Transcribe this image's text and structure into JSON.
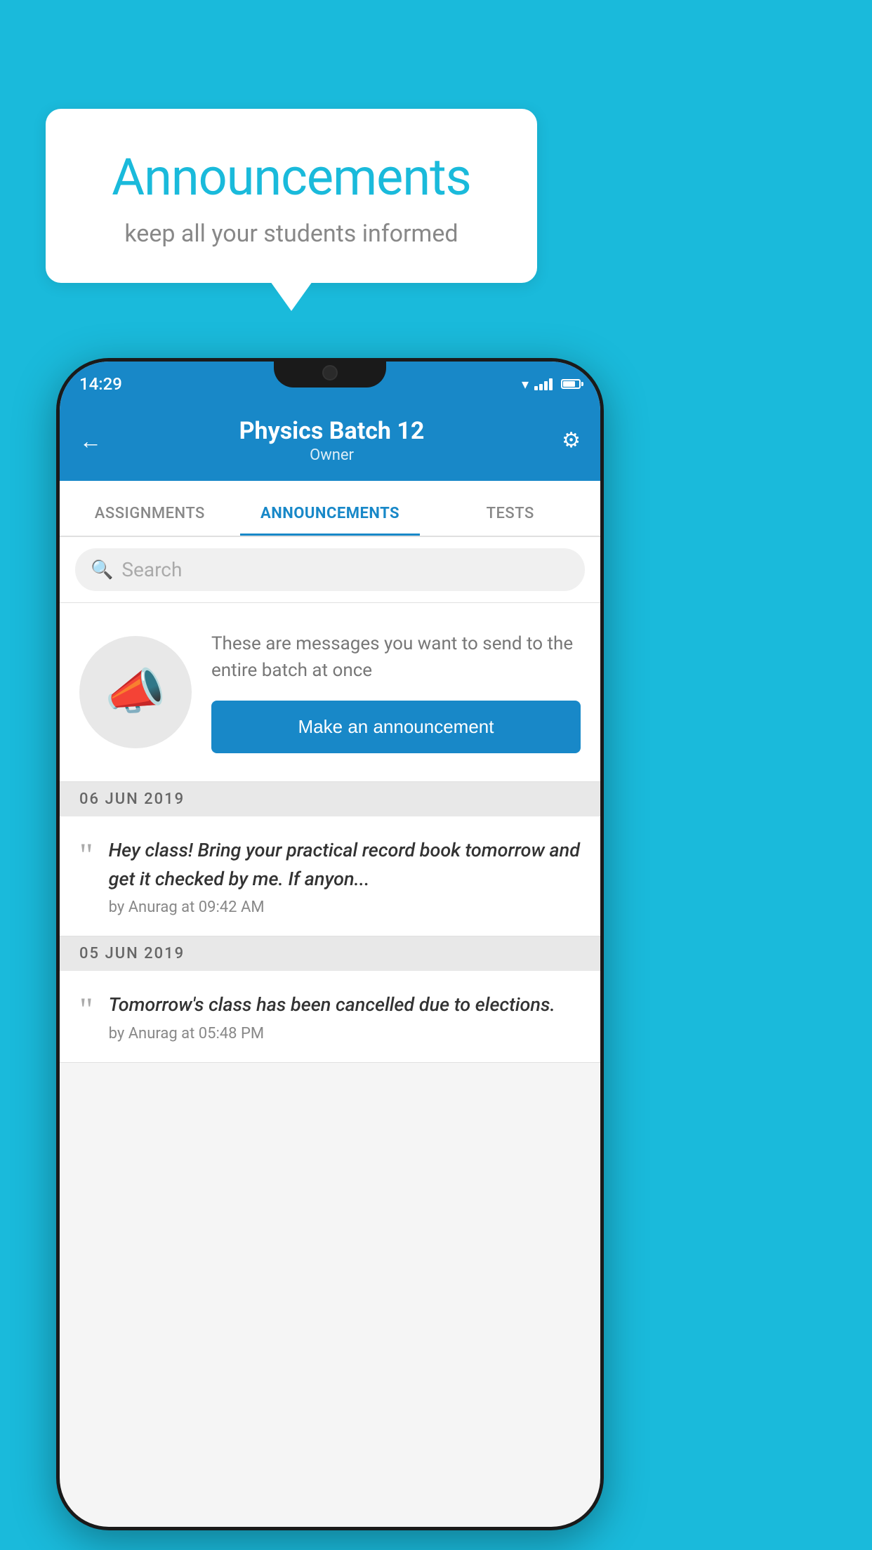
{
  "background": {
    "color": "#1ABADB"
  },
  "speech_bubble": {
    "title": "Announcements",
    "subtitle": "keep all your students informed"
  },
  "phone": {
    "status_bar": {
      "time": "14:29"
    },
    "header": {
      "title": "Physics Batch 12",
      "subtitle": "Owner",
      "back_label": "←",
      "settings_label": "⚙"
    },
    "tabs": [
      {
        "label": "ASSIGNMENTS",
        "active": false
      },
      {
        "label": "ANNOUNCEMENTS",
        "active": true
      },
      {
        "label": "TESTS",
        "active": false
      }
    ],
    "search": {
      "placeholder": "Search"
    },
    "announcement_prompt": {
      "description": "These are messages you want to send to the entire batch at once",
      "button_label": "Make an announcement"
    },
    "announcement_groups": [
      {
        "date": "06  JUN  2019",
        "items": [
          {
            "message": "Hey class! Bring your practical record book tomorrow and get it checked by me. If anyon...",
            "meta": "by Anurag at 09:42 AM"
          }
        ]
      },
      {
        "date": "05  JUN  2019",
        "items": [
          {
            "message": "Tomorrow's class has been cancelled due to elections.",
            "meta": "by Anurag at 05:48 PM"
          }
        ]
      }
    ]
  }
}
